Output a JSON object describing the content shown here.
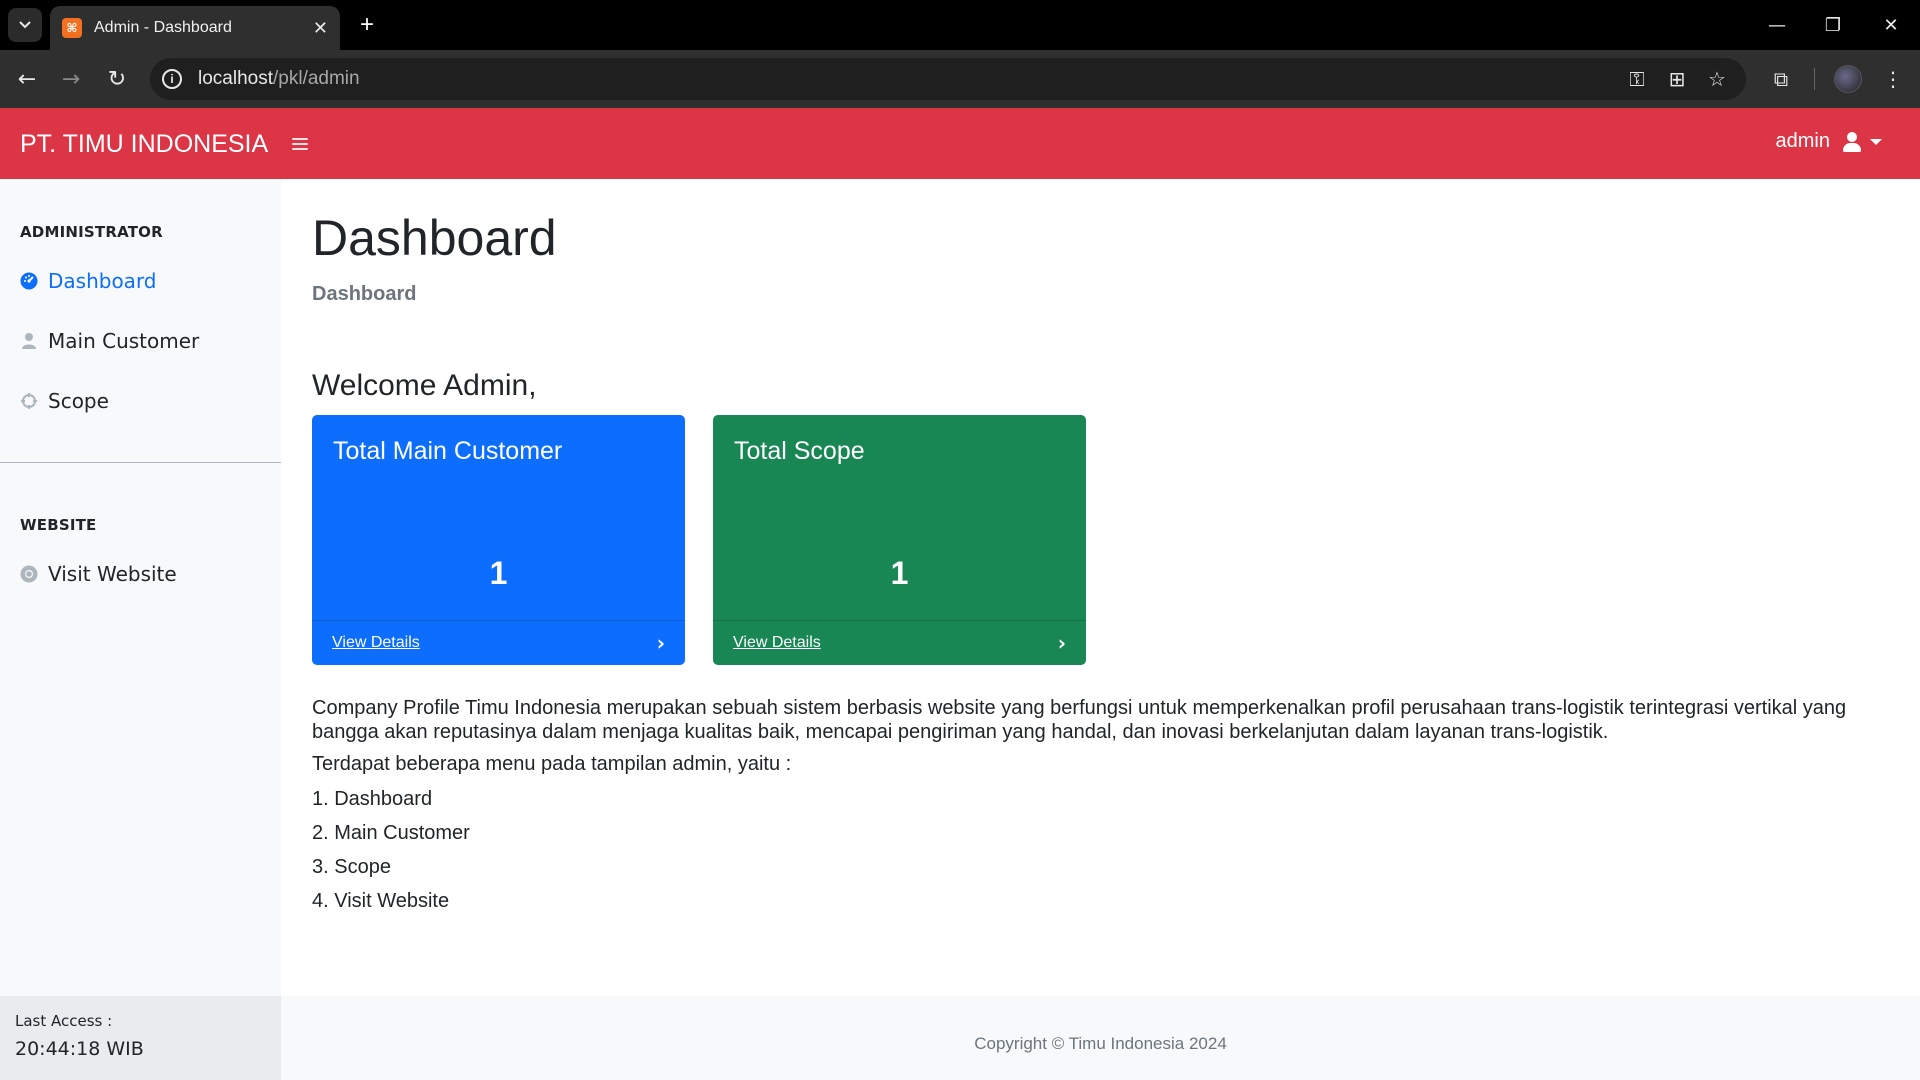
{
  "browser": {
    "tab_title": "Admin - Dashboard",
    "favicon_text": "⌘",
    "url_host": "localhost",
    "url_path": "/pkl/admin",
    "icons": [
      "tab-list-icon",
      "close-icon",
      "plus-icon",
      "minimize-icon",
      "restore-icon",
      "close-window-icon",
      "back-icon",
      "forward-icon",
      "reload-icon",
      "info-icon",
      "key-icon",
      "translate-icon",
      "star-icon",
      "extensions-icon",
      "avatar",
      "menu-dots-icon"
    ]
  },
  "navbar": {
    "brand": "PT. TIMU INDONESIA",
    "user": "admin",
    "color": "#dc3545"
  },
  "sidebar": {
    "section1": "ADMINISTRATOR",
    "items": [
      {
        "label": "Dashboard",
        "icon": "gauge-icon",
        "active": true
      },
      {
        "label": "Main Customer",
        "icon": "user-icon",
        "active": false
      },
      {
        "label": "Scope",
        "icon": "crosshair-icon",
        "active": false
      }
    ],
    "section2": "WEBSITE",
    "website_items": [
      {
        "label": "Visit Website",
        "icon": "chrome-icon"
      }
    ],
    "footer": {
      "label": "Last Access :",
      "time": "20:44:18 WIB"
    }
  },
  "main": {
    "title": "Dashboard",
    "breadcrumb": "Dashboard",
    "welcome": "Welcome Admin,",
    "cards": [
      {
        "title": "Total Main Customer",
        "value": "1",
        "link": "View Details",
        "color": "#0d6efd"
      },
      {
        "title": "Total Scope",
        "value": "1",
        "link": "View Details",
        "color": "#198754"
      }
    ],
    "description": "Company Profile Timu Indonesia merupakan sebuah sistem berbasis website yang berfungsi untuk memperkenalkan profil perusahaan trans-logistik terintegrasi vertikal yang bangga akan reputasinya dalam menjaga kualitas baik, mencapai pengiriman yang handal, dan inovasi berkelanjutan dalam layanan trans-logistik.",
    "menu_intro": "Terdapat beberapa menu pada tampilan admin, yaitu :",
    "menu_list": [
      "1. Dashboard",
      "2. Main Customer",
      "3. Scope",
      "4. Visit Website"
    ]
  },
  "footer": {
    "copyright": "Copyright © Timu Indonesia 2024"
  }
}
